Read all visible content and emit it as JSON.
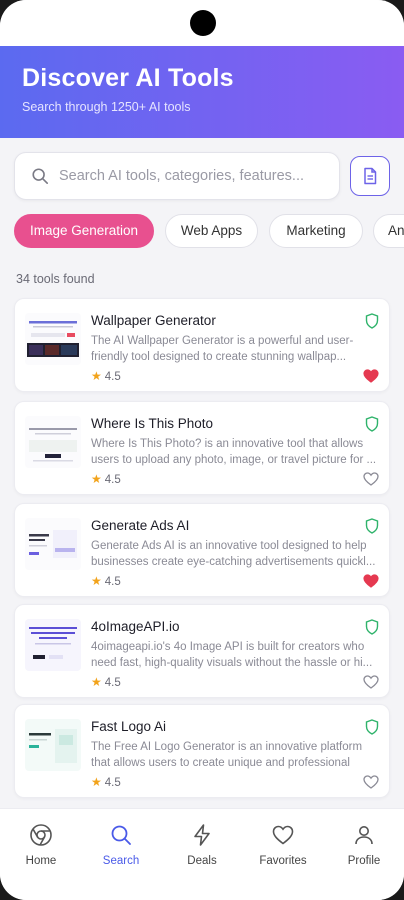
{
  "header": {
    "title": "Discover AI Tools",
    "subtitle": "Search through 1250+ AI tools"
  },
  "search": {
    "placeholder": "Search AI tools, categories, features..."
  },
  "categories": [
    {
      "label": "Image Generation",
      "active": true
    },
    {
      "label": "Web Apps",
      "active": false
    },
    {
      "label": "Marketing",
      "active": false
    },
    {
      "label": "An",
      "active": false
    }
  ],
  "results_count": "34 tools found",
  "tools": [
    {
      "name": "Wallpaper Generator",
      "description": "The AI Wallpaper Generator is a powerful and user-friendly tool designed to create stunning wallpap...",
      "rating": "4.5",
      "favorite": true
    },
    {
      "name": "Where Is This Photo",
      "description": "Where Is This Photo? is an innovative tool that allows users to upload any photo, image, or travel picture for ...",
      "rating": "4.5",
      "favorite": false
    },
    {
      "name": "Generate Ads AI",
      "description": "Generate Ads AI is an innovative tool designed to help businesses create eye-catching advertisements quickl...",
      "rating": "4.5",
      "favorite": true
    },
    {
      "name": "4oImageAPI.io",
      "description": "4oimageapi.io's 4o Image API is built for creators who need fast, high-quality visuals without the hassle or hi...",
      "rating": "4.5",
      "favorite": false
    },
    {
      "name": "Fast Logo Ai",
      "description": "The Free AI Logo Generator is an innovative platform that allows users to create unique and professional log...",
      "rating": "4.5",
      "favorite": false
    }
  ],
  "nav": [
    {
      "label": "Home",
      "icon": "chrome-icon",
      "active": false
    },
    {
      "label": "Search",
      "icon": "search-icon",
      "active": true
    },
    {
      "label": "Deals",
      "icon": "lightning-icon",
      "active": false
    },
    {
      "label": "Favorites",
      "icon": "heart-icon",
      "active": false
    },
    {
      "label": "Profile",
      "icon": "user-icon",
      "active": false
    }
  ],
  "colors": {
    "gradient_start": "#5b6af0",
    "gradient_end": "#8a5cf2",
    "active_chip": "#e8508f",
    "nav_active": "#4a5ae8",
    "favorite": "#e53950",
    "verified": "#2fb36b",
    "star": "#f2a31b"
  }
}
